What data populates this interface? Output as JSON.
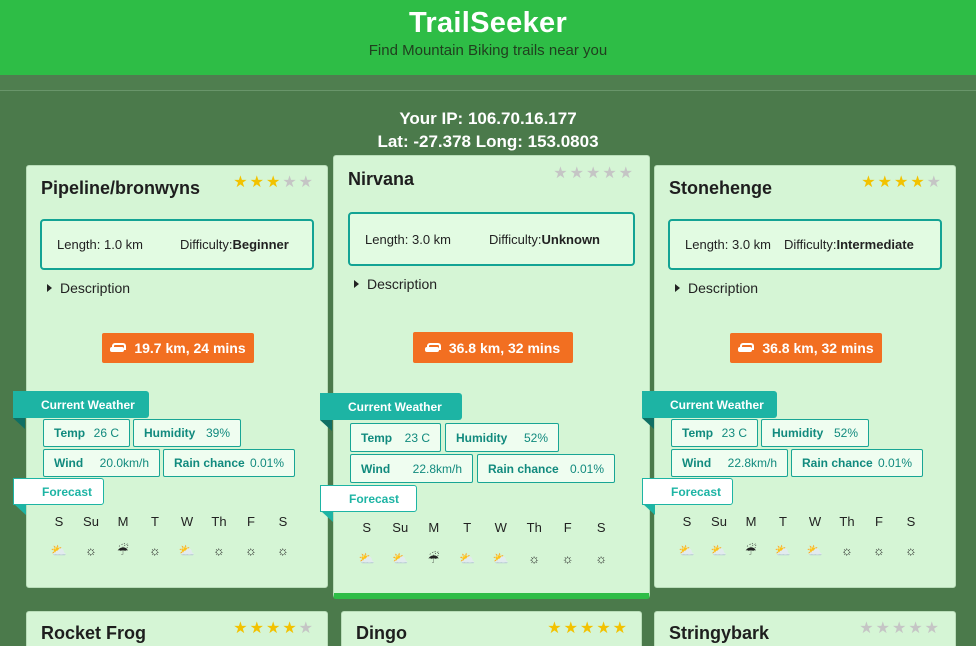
{
  "header": {
    "title": "TrailSeeker",
    "subtitle": "Find Mountain Biking trails near you"
  },
  "ipinfo": {
    "ip_line": "Your IP: 106.70.16.177",
    "coords_line": "Lat: -27.378 Long: 153.0803"
  },
  "labels": {
    "length": "Length:",
    "difficulty": "Difficulty:",
    "description": "Description",
    "current_weather": "Current Weather",
    "forecast": "Forecast",
    "temp": "Temp",
    "humidity": "Humidity",
    "wind": "Wind",
    "rain": "Rain chance"
  },
  "days": [
    "S",
    "Su",
    "M",
    "T",
    "W",
    "Th",
    "F",
    "S"
  ],
  "trails": [
    {
      "name": "Pipeline/bronwyns",
      "rating": 3,
      "length": "1.0 km",
      "difficulty": "Beginner",
      "distance": "19.7 km, 24 mins",
      "temp": "26 C",
      "humidity": "39%",
      "wind": "20.0km/h",
      "rain": "0.01%",
      "forecast_icons": [
        "partly-cloudy-icon",
        "sun-icon",
        "rain-cloud-icon",
        "sun-icon",
        "partly-cloudy-icon",
        "sun-icon",
        "sun-icon",
        "sun-icon"
      ]
    },
    {
      "name": "Nirvana",
      "rating": 0,
      "length": "3.0 km",
      "difficulty": "Unknown",
      "distance": "36.8 km, 32 mins",
      "temp": "23 C",
      "humidity": "52%",
      "wind": "22.8km/h",
      "rain": "0.01%",
      "forecast_icons": [
        "partly-cloudy-icon",
        "partly-cloudy-icon",
        "rain-cloud-icon",
        "partly-cloudy-icon",
        "partly-cloudy-icon",
        "sun-icon",
        "sun-icon",
        "sun-icon"
      ]
    },
    {
      "name": "Stonehenge",
      "rating": 4,
      "length": "3.0 km",
      "difficulty": "Intermediate",
      "distance": "36.8 km, 32 mins",
      "temp": "23 C",
      "humidity": "52%",
      "wind": "22.8km/h",
      "rain": "0.01%",
      "forecast_icons": [
        "partly-cloudy-icon",
        "partly-cloudy-icon",
        "rain-cloud-icon",
        "partly-cloudy-icon",
        "partly-cloudy-icon",
        "sun-icon",
        "sun-icon",
        "sun-icon"
      ]
    }
  ],
  "bottom_trails": [
    {
      "name": "Rocket Frog",
      "rating": 4
    },
    {
      "name": "Dingo",
      "rating": 5
    },
    {
      "name": "Stringybark",
      "rating": 0
    }
  ],
  "colors": {
    "header": "#2ebd46",
    "background": "#4b7a4b",
    "card": "#d5f5d5",
    "accent_teal": "#1db4a4",
    "distance_orange": "#f26f21",
    "star": "#f2c200"
  }
}
